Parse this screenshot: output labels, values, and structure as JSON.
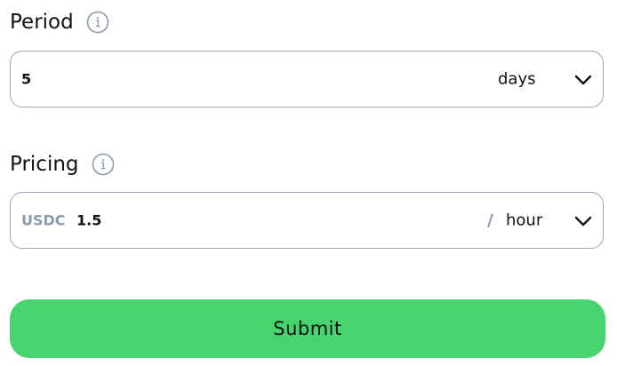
{
  "period": {
    "label": "Period",
    "value": "5",
    "unit": "days"
  },
  "pricing": {
    "label": "Pricing",
    "currency": "USDC",
    "value": "1.5",
    "separator": "/",
    "unit": "hour"
  },
  "submit": {
    "label": "Submit"
  },
  "colors": {
    "submit_bg": "#47d46f",
    "border": "#9aa5b4",
    "muted": "#8c9aae"
  },
  "icons": {
    "info": "info-icon",
    "dropdown": "chevron-down-icon"
  }
}
